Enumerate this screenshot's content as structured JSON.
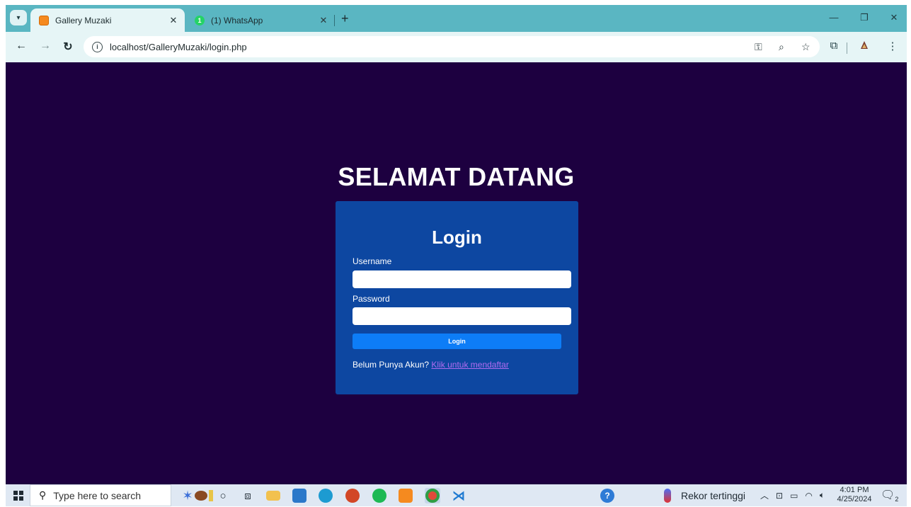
{
  "browser": {
    "tabs": [
      {
        "title": "Gallery Muzaki",
        "close": "✕"
      },
      {
        "title": "(1) WhatsApp",
        "badge": "1",
        "close": "✕"
      }
    ],
    "new_tab": "+",
    "url": "localhost/GalleryMuzaki/login.php",
    "icons": {
      "tab_menu": "chevron-down-icon",
      "back": "back-arrow-icon",
      "forward": "forward-arrow-icon",
      "reload": "reload-icon",
      "site_info": "info-icon",
      "password": "key-icon",
      "zoom": "zoom-icon",
      "bookmark": "star-icon",
      "extensions": "puzzle-icon",
      "profile": "profile-icon",
      "menu": "kebab-menu-icon"
    },
    "window_controls": {
      "minimize": "—",
      "restore": "❐",
      "close": "✕"
    }
  },
  "page": {
    "heading": "SELAMAT DATANG",
    "background_color": "#1d0040",
    "card_color": "#0d47a1",
    "button_color": "#0d7df7",
    "login": {
      "title": "Login",
      "username_label": "Username",
      "username_value": "",
      "password_label": "Password",
      "password_value": "",
      "button_label": "Login",
      "signup_prompt": "Belum Punya Akun?",
      "signup_link": "Klik untuk mendaftar"
    }
  },
  "taskbar": {
    "search_placeholder": "Type here to search",
    "weather": "Rekor tertinggi",
    "time": "4:01 PM",
    "date": "4/25/2024",
    "notification_count": "2",
    "apps": [
      "windows-start-icon",
      "cortana-icon",
      "task-view-icon",
      "file-explorer-icon",
      "store-icon",
      "edge-icon",
      "powerpoint-icon",
      "spotify-icon",
      "xampp-icon",
      "chrome-icon",
      "vscode-icon",
      "help-icon"
    ]
  }
}
